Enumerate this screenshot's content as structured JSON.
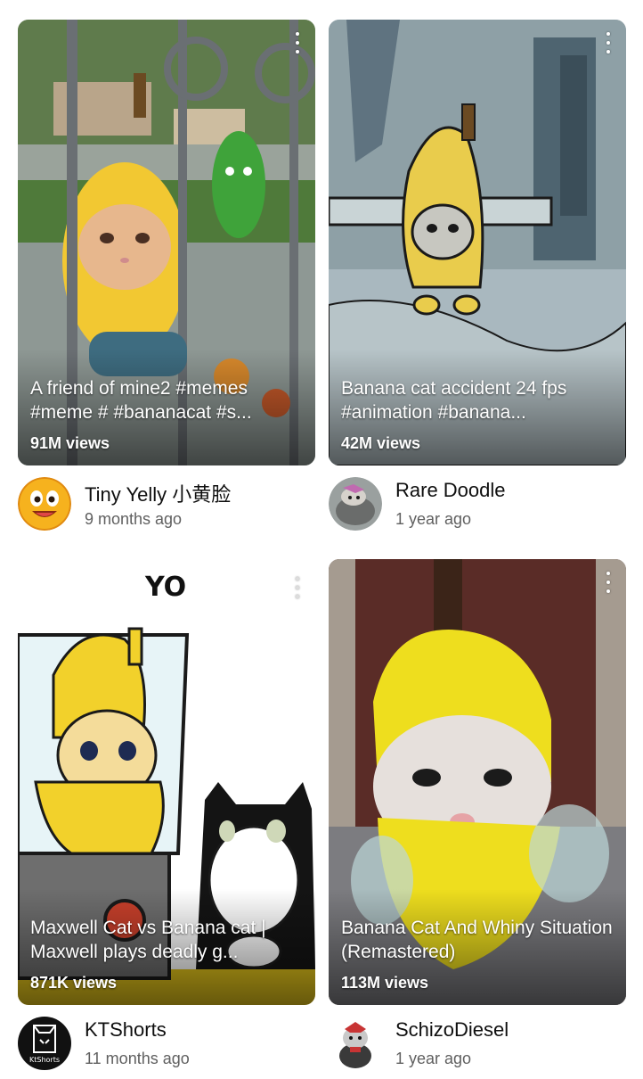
{
  "videos": [
    {
      "title": "A friend of mine2 #memes #meme # #bananacat #s...",
      "views": "91M views",
      "channel": "Tiny Yelly 小黄脸",
      "age": "9 months ago"
    },
    {
      "title": "Banana cat accident 24 fps #animation #banana...",
      "views": "42M views",
      "channel": "Rare Doodle",
      "age": "1 year ago"
    },
    {
      "title": "Maxwell Cat vs Banana cat | Maxwell plays deadly g...",
      "views": "871K views",
      "channel": "KTShorts",
      "age": "11 months ago",
      "overlay_text": "YO",
      "avatar_text": "KtShorts"
    },
    {
      "title": "Banana Cat And Whiny Situation (Remastered)",
      "views": "113M views",
      "channel": "SchizoDiesel",
      "age": "1 year ago"
    }
  ]
}
